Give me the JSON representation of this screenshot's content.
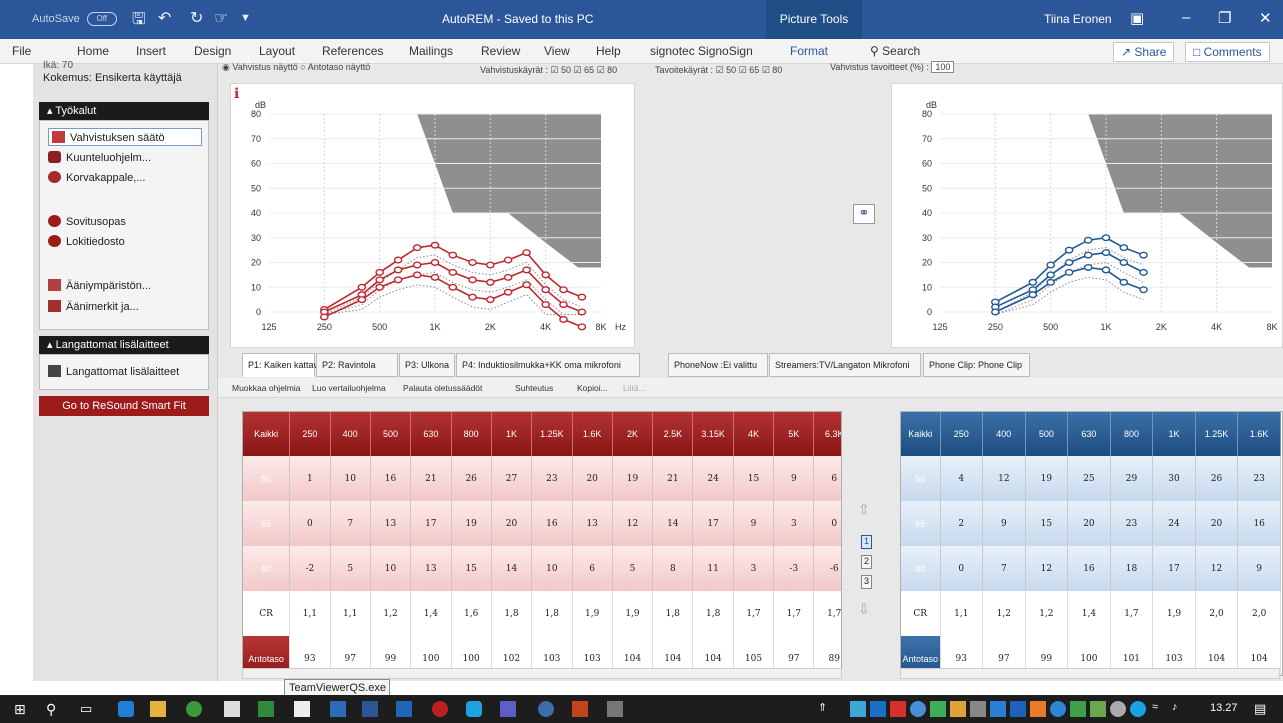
{
  "titlebar": {
    "autosave_label": "AutoSave",
    "autosave_state": "Off",
    "doc_title": "AutoREM - Saved to this PC",
    "context_tab": "Picture Tools",
    "user": "Tiina Eronen"
  },
  "ribbon": {
    "tabs": [
      "File",
      "Home",
      "Insert",
      "Design",
      "Layout",
      "References",
      "Mailings",
      "Review",
      "View",
      "Help",
      "signotec SignoSign",
      "Format"
    ],
    "search": "Search",
    "share": "Share",
    "comments": "Comments"
  },
  "left": {
    "top_text_1": "Ikä: 70",
    "top_text_2": "Kokemus: Ensikerta käyttäjä",
    "tools_header": "Työkalut",
    "tools": [
      "Vahvistuksen säätö",
      "Kuunteluohjelm...",
      "Korvakappale,..."
    ],
    "tools2": [
      "Sovitusopas",
      "Lokitiedosto"
    ],
    "tools3": [
      "Ääniympäristön...",
      "Äänimerkit ja..."
    ],
    "wireless_header": "Langattomat lisälaitteet",
    "wireless_item": "Langattomat lisälaitteet",
    "go_button": "Go to ReSound Smart Fit"
  },
  "options": {
    "radio1": "Vahvistus näyttö",
    "radio2": "Antotaso näyttö",
    "curves_label": "Vahvistuskäyrät :",
    "curves": [
      "50",
      "65",
      "80"
    ],
    "targets_label": "Tavoitekäyrät :",
    "targets": [
      "50",
      "65",
      "80"
    ],
    "target_pct_label": "Vahvistus tavoitteet (%) :",
    "target_pct": "100"
  },
  "chart_left": {
    "ylabel": "dB",
    "xlabel": "Hz",
    "yticks": [
      "80",
      "70",
      "60",
      "50",
      "40",
      "30",
      "20",
      "10",
      "0"
    ],
    "xticks": [
      "125",
      "250",
      "500",
      "1K",
      "2K",
      "4K",
      "8K"
    ]
  },
  "chart_right": {
    "ylabel": "dB",
    "yticks": [
      "80",
      "70",
      "60",
      "50",
      "40",
      "30",
      "20",
      "10",
      "0"
    ],
    "xticks": [
      "125",
      "250",
      "500",
      "1K",
      "2K",
      "4K",
      "8K"
    ]
  },
  "chart_data": [
    {
      "type": "line",
      "x": [
        250,
        400,
        500,
        630,
        800,
        1000,
        1250,
        1600,
        2000,
        2500,
        3150,
        4000,
        5000,
        6300
      ],
      "series": [
        {
          "values": [
            1,
            10,
            16,
            21,
            26,
            27,
            23,
            20,
            19,
            21,
            24,
            15,
            9,
            6
          ]
        },
        {
          "values": [
            0,
            7,
            13,
            17,
            19,
            20,
            16,
            13,
            12,
            14,
            17,
            9,
            3,
            0
          ]
        },
        {
          "values": [
            -2,
            5,
            10,
            13,
            15,
            14,
            10,
            6,
            5,
            8,
            11,
            3,
            -3,
            -6
          ]
        }
      ],
      "ylim": [
        0,
        80
      ],
      "color": "#c0272d"
    },
    {
      "type": "line",
      "x": [
        250,
        400,
        500,
        630,
        800,
        1000,
        1250,
        1600
      ],
      "series": [
        {
          "values": [
            4,
            12,
            19,
            25,
            29,
            30,
            26,
            23
          ]
        },
        {
          "values": [
            2,
            9,
            15,
            20,
            23,
            24,
            20,
            16
          ]
        },
        {
          "values": [
            0,
            7,
            12,
            16,
            18,
            17,
            12,
            9
          ]
        }
      ],
      "ylim": [
        0,
        80
      ],
      "color": "#1f5a96"
    }
  ],
  "program_tabs": [
    "P1: Kaiken kattava",
    "P2: Ravintola",
    "P3: Ulkona",
    "P4: Induktiosilmukka+KK oma mikrofoni",
    "PhoneNow :Ei valittu",
    "Streamers:TV/Langaton Mikrofoni",
    "Phone Clip: Phone Clip"
  ],
  "actions": [
    "Muokkaa ohjelmia",
    "Luo vertailuohjelma",
    "Palauta oletussäädöt",
    "Suhteutus",
    "Kopioi...",
    "Liitä..."
  ],
  "table_red": {
    "all_label": "Kaikki",
    "freqs": [
      "250",
      "400",
      "500",
      "630",
      "800",
      "1K",
      "1.25K",
      "1.6K",
      "2K",
      "2.5K",
      "3.15K",
      "4K",
      "5K",
      "6.3K"
    ],
    "rows": [
      {
        "label": "50",
        "values": [
          "1",
          "10",
          "16",
          "21",
          "26",
          "27",
          "23",
          "20",
          "19",
          "21",
          "24",
          "15",
          "9",
          "6"
        ]
      },
      {
        "label": "65",
        "values": [
          "0",
          "7",
          "13",
          "17",
          "19",
          "20",
          "16",
          "13",
          "12",
          "14",
          "17",
          "9",
          "3",
          "0"
        ]
      },
      {
        "label": "80",
        "values": [
          "-2",
          "5",
          "10",
          "13",
          "15",
          "14",
          "10",
          "6",
          "5",
          "8",
          "11",
          "3",
          "-3",
          "-6"
        ]
      }
    ],
    "cr_label": "CR",
    "cr": [
      "1,1",
      "1,1",
      "1,2",
      "1,4",
      "1,6",
      "1,8",
      "1,8",
      "1,9",
      "1,9",
      "1,8",
      "1,8",
      "1,7",
      "1,7",
      "1,7"
    ],
    "anto_label": "Antotaso",
    "anto": [
      "93",
      "97",
      "99",
      "100",
      "100",
      "102",
      "103",
      "103",
      "104",
      "104",
      "104",
      "105",
      "97",
      "89"
    ]
  },
  "table_blue": {
    "all_label": "Kaikki",
    "freqs": [
      "250",
      "400",
      "500",
      "630",
      "800",
      "1K",
      "1.25K",
      "1.6K"
    ],
    "rows": [
      {
        "label": "50",
        "values": [
          "4",
          "12",
          "19",
          "25",
          "29",
          "30",
          "26",
          "23"
        ]
      },
      {
        "label": "65",
        "values": [
          "2",
          "9",
          "15",
          "20",
          "23",
          "24",
          "20",
          "16"
        ]
      },
      {
        "label": "80",
        "values": [
          "0",
          "7",
          "12",
          "16",
          "18",
          "17",
          "12",
          "9"
        ]
      }
    ],
    "cr_label": "CR",
    "cr": [
      "1,1",
      "1,2",
      "1,2",
      "1,4",
      "1,7",
      "1,9",
      "2,0",
      "2,0"
    ],
    "anto_label": "Antotaso",
    "anto": [
      "93",
      "97",
      "99",
      "100",
      "101",
      "103",
      "104",
      "104"
    ]
  },
  "level_buttons": [
    "1",
    "2",
    "3"
  ],
  "tooltip": "TeamViewerQS.exe",
  "taskbar": {
    "time": "13.27"
  }
}
